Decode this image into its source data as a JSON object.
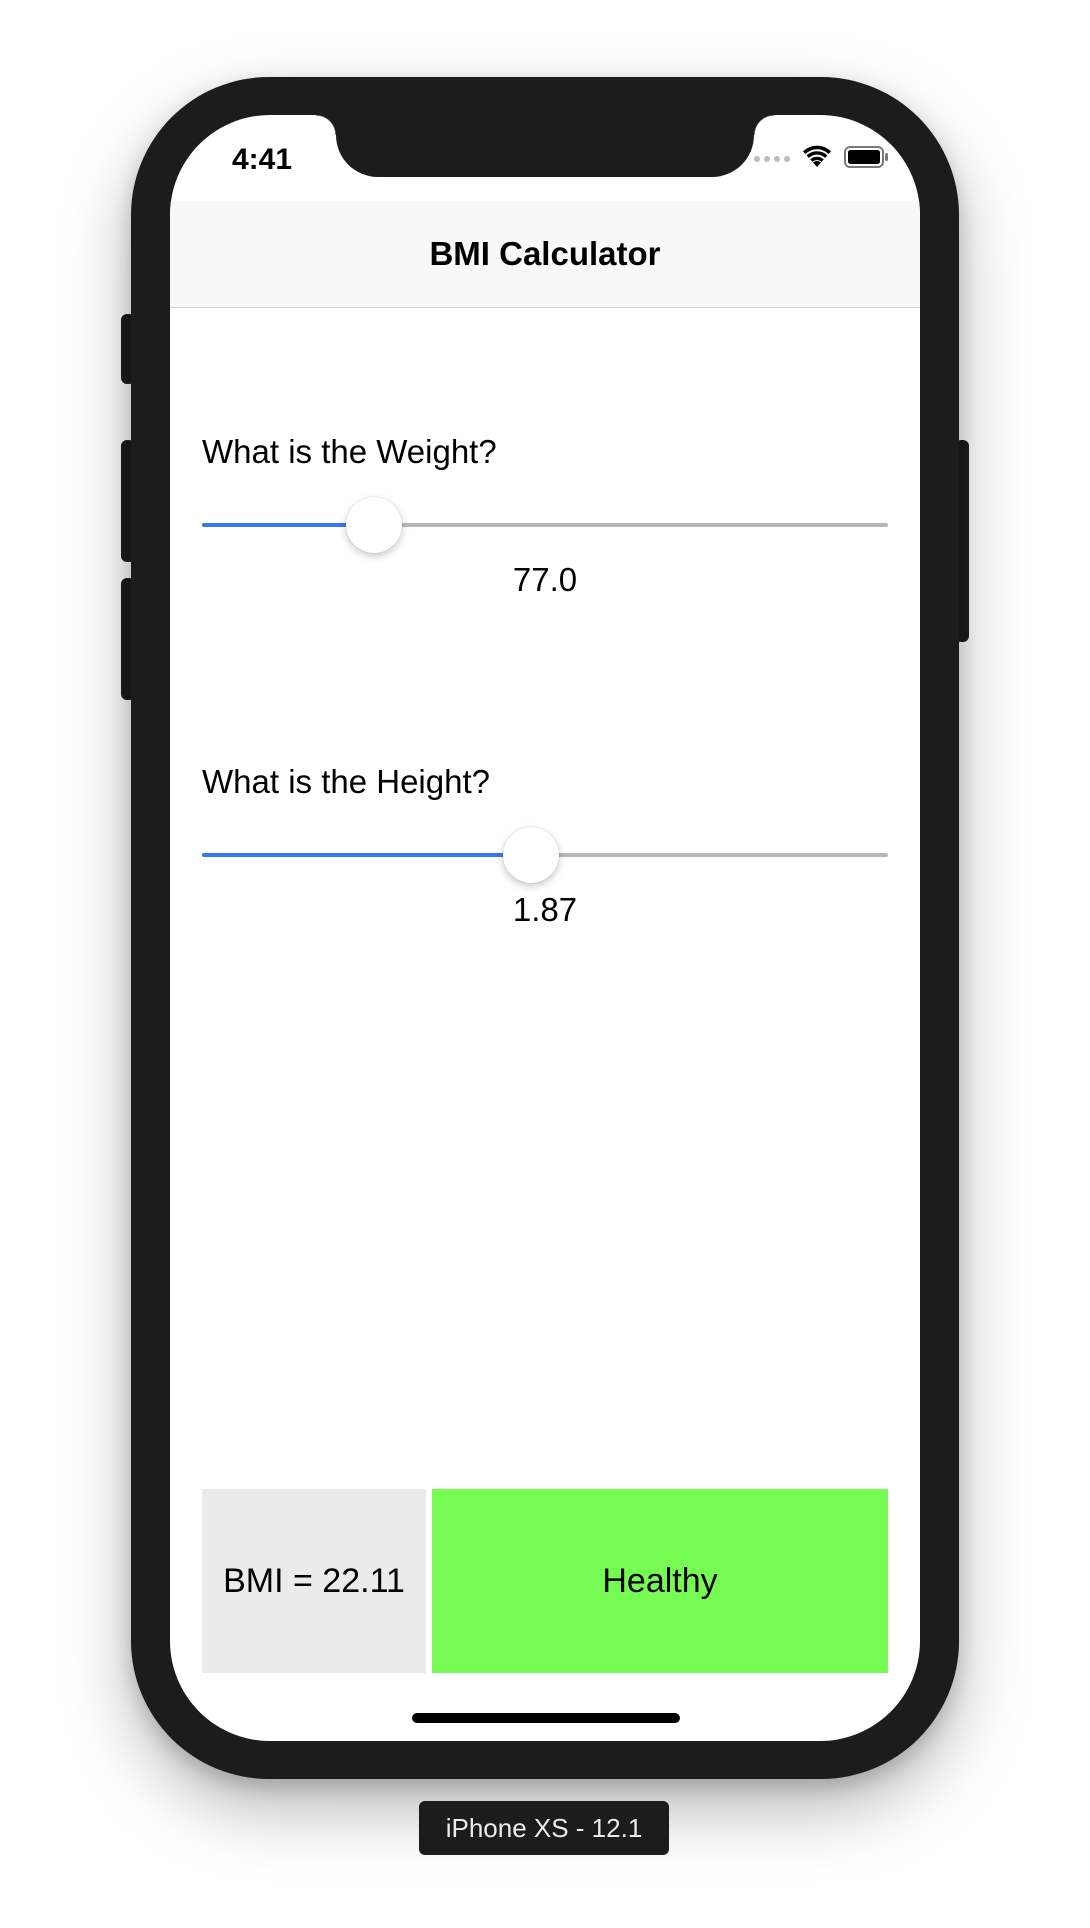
{
  "status_bar": {
    "time": "4:41",
    "icons": [
      "signal-dots-icon",
      "wifi-icon",
      "battery-icon"
    ]
  },
  "navbar": {
    "title": "BMI Calculator"
  },
  "weight": {
    "label": "What is the Weight?",
    "value_text": "77.0",
    "slider_fraction": 0.25
  },
  "height": {
    "label": "What is the Height?",
    "value_text": "1.87",
    "slider_fraction": 0.48
  },
  "result": {
    "bmi_text": "BMI = 22.11",
    "status_text": "Healthy",
    "status_color": "#76fb52"
  },
  "colors": {
    "accent": "#3478f6",
    "track": "#b8b8b8",
    "bmi_box": "#ebebeb"
  },
  "simulator_caption": "iPhone XS - 12.1"
}
